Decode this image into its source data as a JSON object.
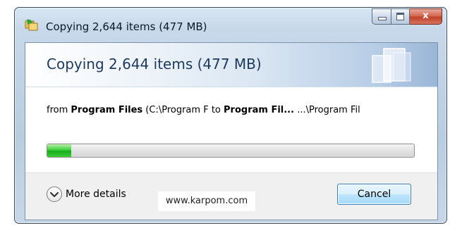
{
  "window": {
    "title": "Copying 2,644 items (477 MB)",
    "close_glyph": "x"
  },
  "header": {
    "heading": "Copying 2,644 items (477 MB)"
  },
  "transfer": {
    "from_word": "from ",
    "source_name": "Program Files",
    "source_path": " (C:\\Program F",
    "to_word": " to ",
    "dest_name": "Program Fil...",
    "dest_path": " ...\\Program Fil"
  },
  "progress": {
    "fraction": 0.065,
    "fill_color": "#1fb52a"
  },
  "footer": {
    "details_label": "More details",
    "watermark": "www.karpom.com",
    "cancel_label": "Cancel"
  },
  "icons": {
    "app": "copy-folders-icon",
    "details": "chevron-down-icon",
    "header_graphic": "documents-icon"
  },
  "colors": {
    "heading": "#1e395b",
    "close_button": "#c7432c",
    "cancel_border": "#3c7fb1"
  }
}
